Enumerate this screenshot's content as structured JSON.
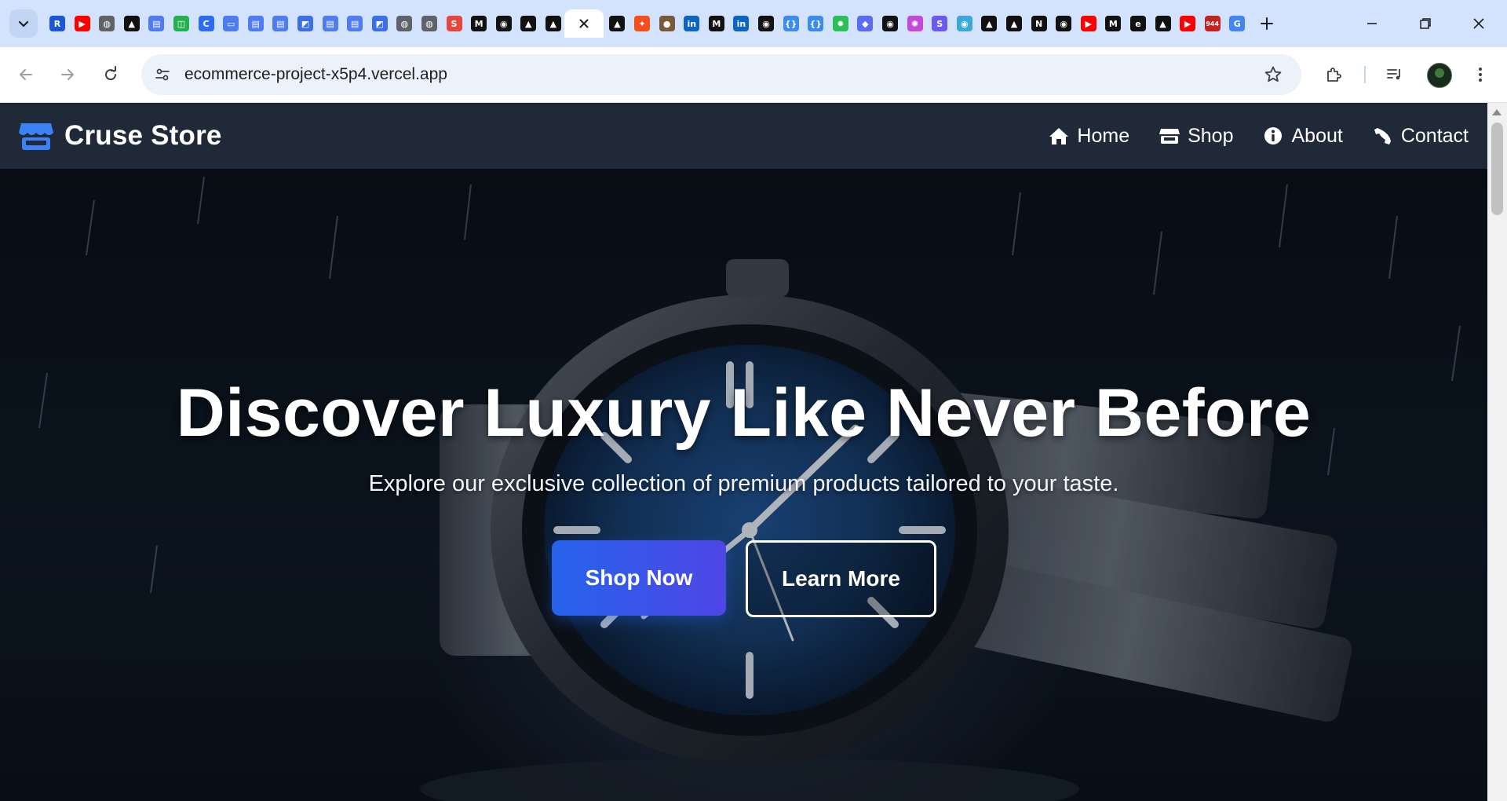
{
  "browser": {
    "tab_favicons": [
      {
        "icon": "r-logo-icon",
        "color": "#1a56d6",
        "glyph": "R"
      },
      {
        "icon": "youtube-icon",
        "color": "#ff0000",
        "glyph": "▶"
      },
      {
        "icon": "globe-icon",
        "color": "#5f6368",
        "glyph": "◍"
      },
      {
        "icon": "triangle-icon",
        "color": "#111111",
        "glyph": "▲"
      },
      {
        "icon": "image-icon",
        "color": "#4f7cf0",
        "glyph": "▤"
      },
      {
        "icon": "screenshot-icon",
        "color": "#22b14c",
        "glyph": "◫"
      },
      {
        "icon": "c-logo-icon",
        "color": "#2b6cf0",
        "glyph": "C"
      },
      {
        "icon": "printer-icon",
        "color": "#4f7cf0",
        "glyph": "▭"
      },
      {
        "icon": "image-icon",
        "color": "#4f7cf0",
        "glyph": "▤"
      },
      {
        "icon": "image-icon",
        "color": "#4f7cf0",
        "glyph": "▤"
      },
      {
        "icon": "gradient-icon",
        "color": "#3b6fe8",
        "glyph": "◩"
      },
      {
        "icon": "image-icon",
        "color": "#4f7cf0",
        "glyph": "▤"
      },
      {
        "icon": "image-icon",
        "color": "#4f7cf0",
        "glyph": "▤"
      },
      {
        "icon": "gradient-icon",
        "color": "#3b6fe8",
        "glyph": "◩"
      },
      {
        "icon": "globe-icon",
        "color": "#5f6368",
        "glyph": "◍"
      },
      {
        "icon": "globe-icon",
        "color": "#5f6368",
        "glyph": "◍"
      },
      {
        "icon": "s-logo-icon",
        "color": "#e8453c",
        "glyph": "S"
      },
      {
        "icon": "medium-icon",
        "color": "#111111",
        "glyph": "M"
      },
      {
        "icon": "github-icon",
        "color": "#111111",
        "glyph": "◉"
      },
      {
        "icon": "triangle-icon",
        "color": "#111111",
        "glyph": "▲"
      },
      {
        "icon": "triangle-icon",
        "color": "#111111",
        "glyph": "▲"
      }
    ],
    "tab_favicons_after": [
      {
        "icon": "triangle-icon",
        "color": "#111111",
        "glyph": "▲"
      },
      {
        "icon": "figma-icon",
        "color": "#f24e1e",
        "glyph": "✦"
      },
      {
        "icon": "portrait-icon",
        "color": "#7a5a3a",
        "glyph": "●"
      },
      {
        "icon": "linkedin-icon",
        "color": "#0a66c2",
        "glyph": "in"
      },
      {
        "icon": "medium-icon",
        "color": "#111111",
        "glyph": "M"
      },
      {
        "icon": "linkedin-icon",
        "color": "#0a66c2",
        "glyph": "in"
      },
      {
        "icon": "github-icon",
        "color": "#111111",
        "glyph": "◉"
      },
      {
        "icon": "braces-icon",
        "color": "#3b8cf0",
        "glyph": "{}"
      },
      {
        "icon": "braces-icon",
        "color": "#3b8cf0",
        "glyph": "{}"
      },
      {
        "icon": "gear-icon",
        "color": "#2bbf5a",
        "glyph": "✹"
      },
      {
        "icon": "shield-icon",
        "color": "#5b6cf0",
        "glyph": "◆"
      },
      {
        "icon": "github-icon",
        "color": "#111111",
        "glyph": "◉"
      },
      {
        "icon": "react-icon",
        "color": "#c04bd6",
        "glyph": "✺"
      },
      {
        "icon": "s-logo-icon",
        "color": "#6a5af0",
        "glyph": "S"
      },
      {
        "icon": "map-pin-icon",
        "color": "#3aa8d8",
        "glyph": "◉"
      },
      {
        "icon": "triangle-icon",
        "color": "#111111",
        "glyph": "▲"
      },
      {
        "icon": "triangle-icon",
        "color": "#111111",
        "glyph": "▲"
      },
      {
        "icon": "notion-icon",
        "color": "#111111",
        "glyph": "N"
      },
      {
        "icon": "github-icon",
        "color": "#111111",
        "glyph": "◉"
      },
      {
        "icon": "youtube-icon",
        "color": "#ff0000",
        "glyph": "▶"
      },
      {
        "icon": "medium-icon",
        "color": "#111111",
        "glyph": "M"
      },
      {
        "icon": "e-logo-icon",
        "color": "#111111",
        "glyph": "e"
      },
      {
        "icon": "triangle-icon",
        "color": "#111111",
        "glyph": "▲"
      },
      {
        "icon": "youtube-icon",
        "color": "#ff0000",
        "glyph": "▶"
      },
      {
        "icon": "badge-count-icon",
        "color": "#c5221f",
        "glyph": "944"
      },
      {
        "icon": "google-icon",
        "color": "#4285f4",
        "glyph": "G"
      },
      {
        "icon": "openai-icon",
        "color": "#444444",
        "glyph": "✿"
      }
    ],
    "url": "ecommerce-project-x5p4.vercel.app"
  },
  "site": {
    "brand": "Cruse Store",
    "nav": [
      {
        "label": "Home",
        "icon": "home-icon"
      },
      {
        "label": "Shop",
        "icon": "store-icon"
      },
      {
        "label": "About",
        "icon": "info-icon"
      },
      {
        "label": "Contact",
        "icon": "phone-icon"
      }
    ],
    "hero": {
      "title": "Discover Luxury Like Never Before",
      "subtitle": "Explore our exclusive collection of premium products tailored to your taste.",
      "primary_cta": "Shop Now",
      "secondary_cta": "Learn More"
    }
  },
  "colors": {
    "nav_bg": "#1f2937",
    "accent_blue": "#2563eb",
    "accent_indigo": "#4f46e5",
    "brand_icon": "#3b82f6"
  }
}
